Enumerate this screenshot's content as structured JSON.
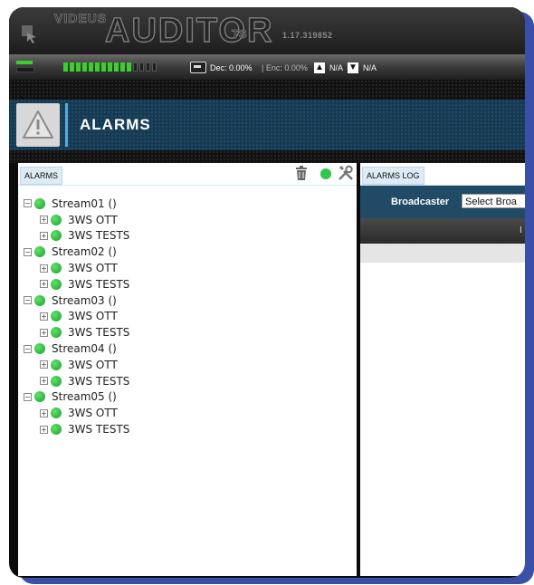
{
  "app": {
    "brand_small": "VIDEUS",
    "brand_big": "AUDITOR",
    "brand_suffix": "TS",
    "version": "1.17.319852"
  },
  "status": {
    "dec_label": "Dec: 0.00%",
    "enc_label": "| Enc: 0.00%",
    "upload_value": "N/A",
    "download_value": "N/A",
    "meter_segments": {
      "green": 11,
      "dark": 4,
      "green_color": "#3bcf2c",
      "dark_color": "#1f1f1f"
    }
  },
  "header": {
    "title": "ALARMS",
    "icon": "warning-triangle-icon"
  },
  "left_panel": {
    "tab_label": "ALARMS",
    "toolbar_icons": [
      "trash-icon",
      "status-dot-icon",
      "tools-icon"
    ],
    "streams": [
      {
        "label": "Stream01 ()",
        "children": [
          "3WS OTT",
          "3WS TESTS"
        ]
      },
      {
        "label": "Stream02 ()",
        "children": [
          "3WS OTT",
          "3WS TESTS"
        ]
      },
      {
        "label": "Stream03 ()",
        "children": [
          "3WS OTT",
          "3WS TESTS"
        ]
      },
      {
        "label": "Stream04 ()",
        "children": [
          "3WS OTT",
          "3WS TESTS"
        ]
      },
      {
        "label": "Stream05 ()",
        "children": [
          "3WS OTT",
          "3WS TESTS"
        ]
      }
    ]
  },
  "right_panel": {
    "tab_label": "ALARMS LOG",
    "broadcaster_label": "Broadcaster",
    "broadcaster_select": "Select Broa",
    "column_header": "I"
  },
  "colors": {
    "status_ok": "#2fc84a",
    "header_bg": "#173a52",
    "accent_blue": "#3a4fa8"
  }
}
